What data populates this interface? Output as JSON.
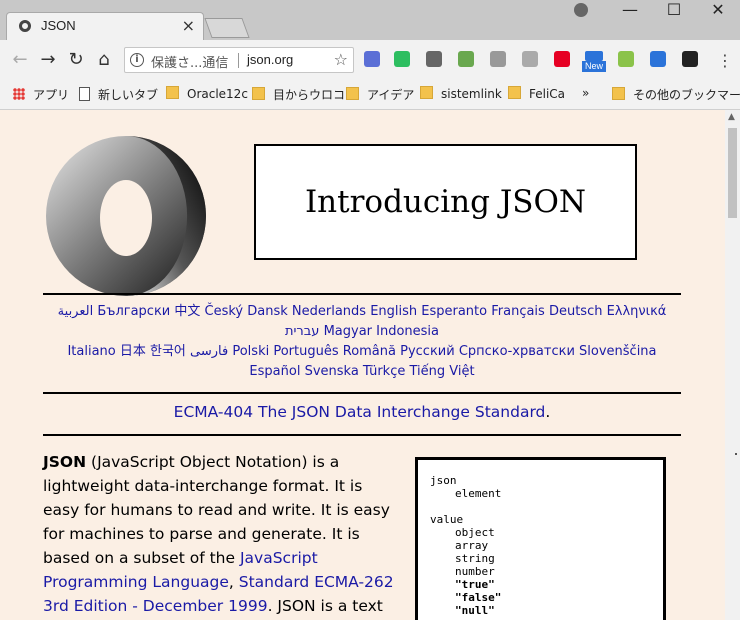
{
  "browser": {
    "tab_title": "JSON",
    "tab_close": "×",
    "window": {
      "minimize": "—",
      "maximize": "☐",
      "close": "✕"
    },
    "nav": {
      "back": "←",
      "forward": "→",
      "reload": "↻",
      "home": "⌂"
    },
    "omnibox": {
      "info_glyph": "i",
      "secure_label": "保護さ...通信",
      "url": "json.org",
      "star": "☆"
    },
    "extensions": [
      {
        "name": "pen-extension-icon",
        "color": "#5b6fd6"
      },
      {
        "name": "evernote-icon",
        "color": "#2dbe60"
      },
      {
        "name": "gesture-extension-icon",
        "color": "#666666"
      },
      {
        "name": "sheet-extension-icon",
        "color": "#6aa84f"
      },
      {
        "name": "bolt-extension-icon",
        "color": "#999999"
      },
      {
        "name": "rss-icon",
        "color": "#aaaaaa"
      },
      {
        "name": "pinterest-icon",
        "color": "#e60023"
      },
      {
        "name": "android-icon",
        "color": "#8bc34a"
      },
      {
        "name": "code-extension-icon",
        "color": "#2b73d9"
      },
      {
        "name": "terminal-extension-icon",
        "color": "#222222"
      }
    ],
    "new_badge": "New",
    "menu": "⋮",
    "bookmarks": {
      "apps": "アプリ",
      "new_tab": "新しいタブ",
      "folders": [
        "Oracle12c",
        "目からウロコ",
        "アイデア",
        "sistemlink",
        "FeliCa"
      ],
      "overflow": "»",
      "other": "その他のブックマーク"
    }
  },
  "page": {
    "title": "Introducing JSON",
    "languages": [
      "العربية Български 中文 Český Dansk Nederlands English Esperanto Français Deutsch Ελληνικά",
      "עברית Magyar Indonesia",
      "Italiano 日本 한국어 فارسی Polski Português Română Русский Српско-хрватски Slovenščina",
      "Español Svenska Türkçe Tiếng Việt"
    ],
    "ecma_link": "ECMA-404 The JSON Data Interchange Standard",
    "ecma_period": ".",
    "intro": {
      "bold": "JSON",
      "text1": " (JavaScript Object Notation) is a lightweight data-interchange format. It is easy for humans to read and write. It is easy for machines to parse and generate. It is based on a subset of the ",
      "link1": "JavaScript Programming Language",
      "text2": ", ",
      "link2": "Standard ECMA-262 3rd Edition - December 1999",
      "text3": ". JSON is a text"
    },
    "grammar": {
      "json": "json",
      "element": "element",
      "value": "value",
      "object": "object",
      "array": "array",
      "string": "string",
      "number": "number",
      "true": "\"true\"",
      "false": "\"false\"",
      "null": "\"null\""
    }
  }
}
